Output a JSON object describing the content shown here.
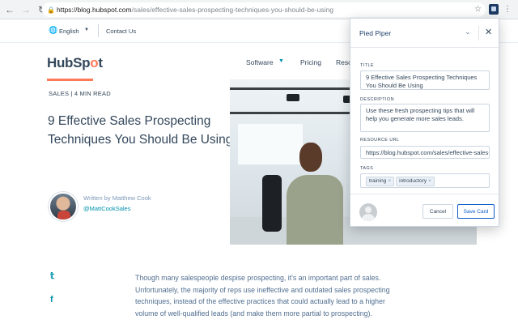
{
  "browser": {
    "url_host": "https://blog.hubspot.com",
    "url_path": "/sales/effective-sales-prospecting-techniques-you-should-be-using",
    "back_icon": "arrow-left-icon",
    "forward_icon": "arrow-right-icon",
    "reload_icon": "reload-icon",
    "bookmark_icon": "star-icon"
  },
  "utility_nav": {
    "language": "English",
    "contact": "Contact Us"
  },
  "site": {
    "logo_prefix": "HubSp",
    "logo_o": "o",
    "logo_suffix": "t",
    "nav": [
      "Software",
      "Pricing",
      "Reso"
    ]
  },
  "article": {
    "kicker": "SALES | 4 MIN READ",
    "title": "9 Effective Sales Prospecting Techniques You Should Be Using",
    "byline": "Written by Matthew Cook",
    "handle": "@MattCookSales",
    "body": "Though many salespeople despise prospecting, it's an important part of sales. Unfortunately, the majority of reps use ineffective and outdated sales prospecting techniques, instead of the effective practices that could actually lead to a higher volume of well-qualified leads (and make them more partial to prospecting)."
  },
  "social_icons": [
    "twitter-icon",
    "facebook-icon"
  ],
  "popup": {
    "workspace": "Pied Piper",
    "title_label": "TITLE",
    "title_value": "9 Effective Sales Prospecting Techniques You Should Be Using",
    "description_label": "DESCRIPTION",
    "description_value": "Use these fresh prospecting tips that will help you generate more sales leads.",
    "resource_url_label": "RESOURCE URL",
    "resource_url_value": "https://blog.hubspot.com/sales/effective-sales-prospecting-techniques-you-should-be-using",
    "tags_label": "TAGS",
    "tags": [
      "training",
      "introductory"
    ],
    "cancel_label": "Cancel",
    "save_label": "Save Card"
  }
}
